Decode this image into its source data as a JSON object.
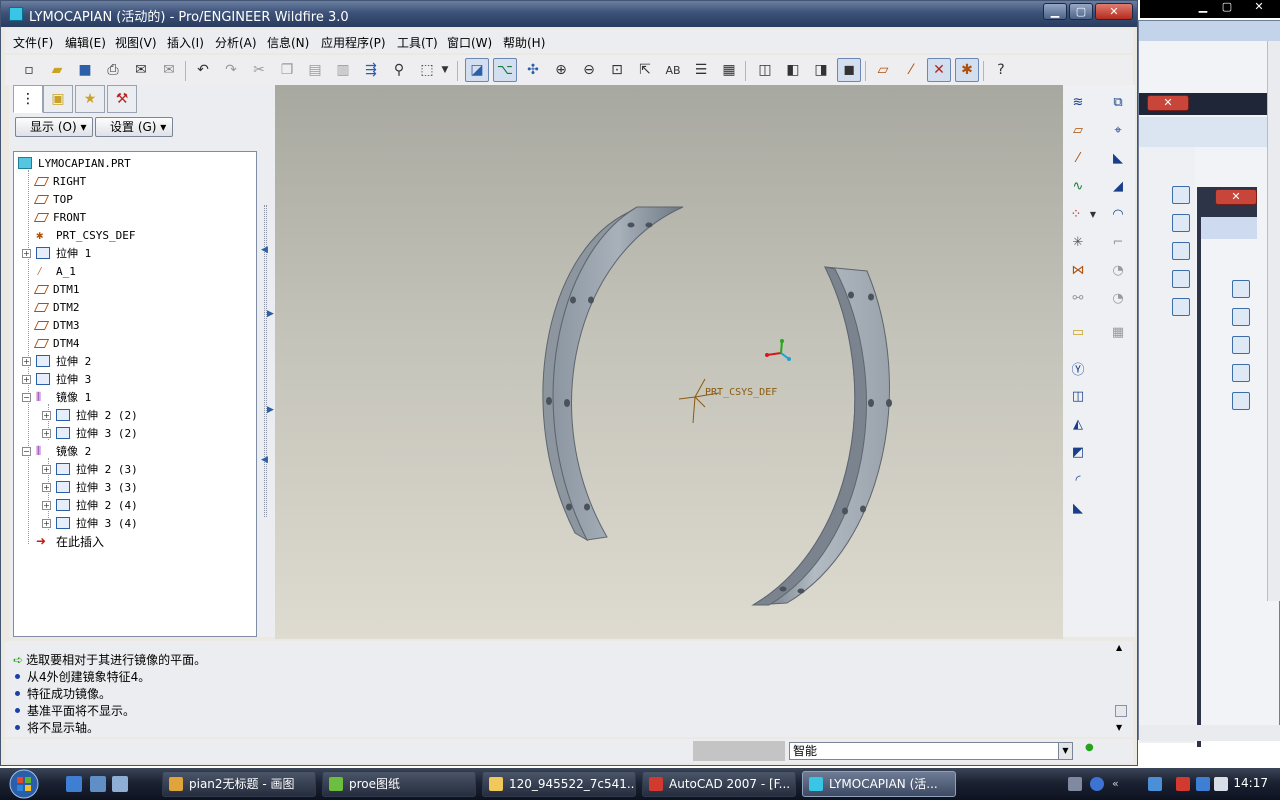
{
  "window": {
    "title": "LYMOCAPIAN (活动的) - Pro/ENGINEER Wildfire 3.0",
    "minimize": "▁",
    "maximize": "▢",
    "close": "✕"
  },
  "menu": [
    "文件(F)",
    "编辑(E)",
    "视图(V)",
    "插入(I)",
    "分析(A)",
    "信息(N)",
    "应用程序(P)",
    "工具(T)",
    "窗口(W)",
    "帮助(H)"
  ],
  "model_tree": {
    "show_button": "显示 (O) ▾",
    "settings_button": "设置 (G) ▾",
    "root": "LYMOCAPIAN.PRT",
    "nodes": [
      {
        "label": "RIGHT",
        "icon": "datum-plane-icon"
      },
      {
        "label": "TOP",
        "icon": "datum-plane-icon"
      },
      {
        "label": "FRONT",
        "icon": "datum-plane-icon"
      },
      {
        "label": "PRT_CSYS_DEF",
        "icon": "csys-icon"
      },
      {
        "label": "拉伸 1",
        "icon": "extrude-icon"
      },
      {
        "label": "A_1",
        "icon": "axis-icon"
      },
      {
        "label": "DTM1",
        "icon": "datum-plane-icon"
      },
      {
        "label": "DTM2",
        "icon": "datum-plane-icon"
      },
      {
        "label": "DTM3",
        "icon": "datum-plane-icon"
      },
      {
        "label": "DTM4",
        "icon": "datum-plane-icon"
      },
      {
        "label": "拉伸 2",
        "icon": "extrude-icon"
      },
      {
        "label": "拉伸 3",
        "icon": "extrude-icon"
      },
      {
        "label": "镜像 1",
        "icon": "mirror-icon"
      },
      {
        "label": "拉伸 2 (2)",
        "icon": "extrude-icon"
      },
      {
        "label": "拉伸 3 (2)",
        "icon": "extrude-icon"
      },
      {
        "label": "镜像 2",
        "icon": "mirror-icon"
      },
      {
        "label": "拉伸 2 (3)",
        "icon": "extrude-icon"
      },
      {
        "label": "拉伸 3 (3)",
        "icon": "extrude-icon"
      },
      {
        "label": "拉伸 2 (4)",
        "icon": "extrude-icon"
      },
      {
        "label": "拉伸 3 (4)",
        "icon": "extrude-icon"
      },
      {
        "label": "在此插入",
        "icon": "insert-here-icon"
      }
    ]
  },
  "graphics": {
    "csys_label": "PRT_CSYS_DEF"
  },
  "messages": [
    "选取要相对于其进行镜像的平面。",
    "从4外创建镜象特征4。",
    "特征成功镜像。",
    "基准平面将不显示。",
    "将不显示轴。"
  ],
  "status": {
    "filter_value": "智能"
  },
  "taskbar": {
    "tasks": [
      "pian2无标题 - 画图",
      "proe图纸",
      "120_945522_7c541...",
      "AutoCAD 2007 - [F...",
      "LYMOCAPIAN (活..."
    ],
    "clock": "14:17"
  },
  "colors": {
    "accent": "#3d5278",
    "part_gray": "#9ea6ae"
  }
}
